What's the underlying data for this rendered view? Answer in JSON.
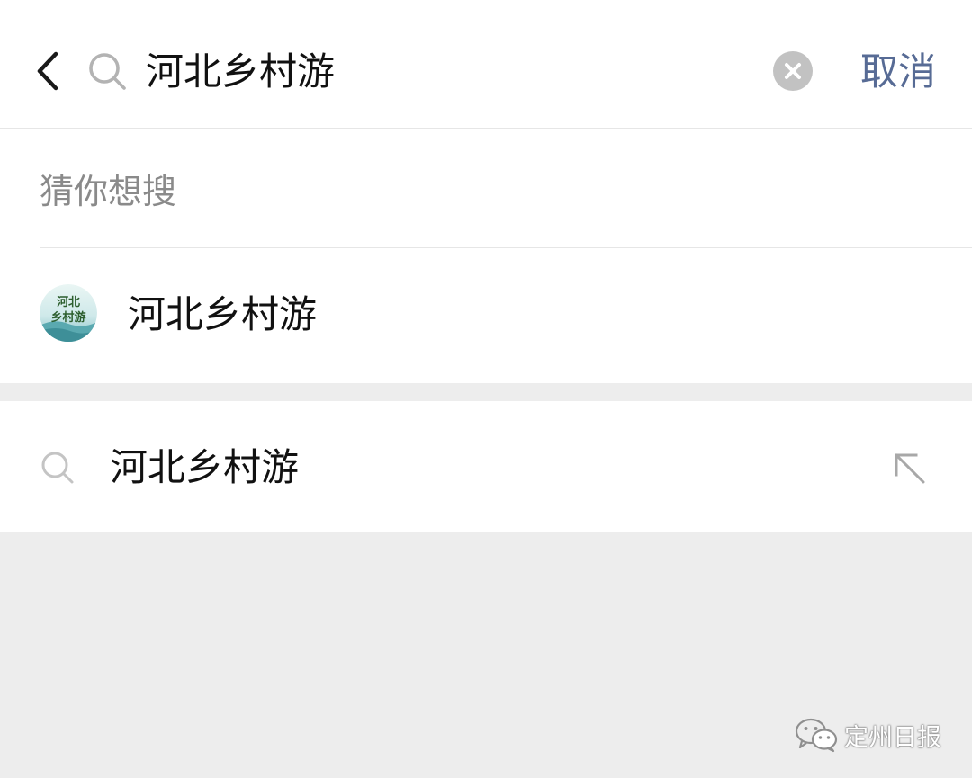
{
  "search_bar": {
    "query": "河北乡村游",
    "cancel_label": "取消",
    "icons": {
      "back": "chevron-left-icon",
      "search": "search-icon",
      "clear": "clear-circle-x-icon"
    }
  },
  "suggestions": {
    "heading": "猜你想搜",
    "account": {
      "name": "河北乡村游",
      "avatar_text_line1": "河北",
      "avatar_text_line2": "乡村游"
    }
  },
  "query_item": {
    "text": "河北乡村游",
    "icons": {
      "search": "search-icon",
      "fill": "arrow-up-left-icon"
    }
  },
  "watermark": {
    "text": "定州日报"
  },
  "colors": {
    "accent_link": "#576b95",
    "background": "#ededed",
    "text_primary": "#111111",
    "text_secondary": "#8a8a8a"
  }
}
